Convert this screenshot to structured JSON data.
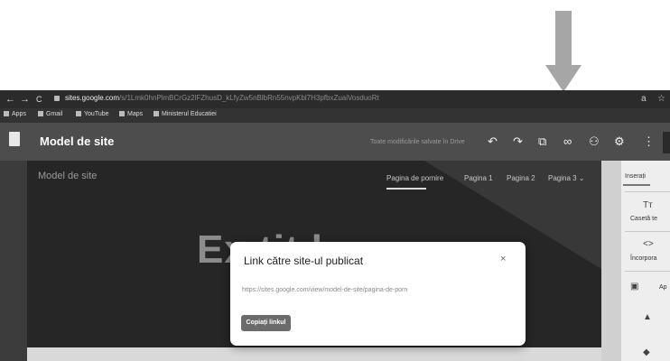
{
  "browser": {
    "url_host": "sites.google.com",
    "url_rest": "/s/1Lmk0hnPlmBCrGz2lFZhusD_kLfyZw5nBlbRn55nvpKbl7H3pfbxZuaiVosduoRt",
    "nav_back": "←",
    "nav_forward": "→",
    "nav_reload": "C",
    "ext1": "a",
    "ext2": "☆",
    "bookmarks": [
      "Apps",
      "Gmail",
      "YouTube",
      "Maps",
      "Ministerul Educatiei"
    ]
  },
  "editor": {
    "site_title": "Model de site",
    "saved_status": "Toate modificările salvate în Drive",
    "tools": {
      "undo": "↶",
      "redo": "↷",
      "preview": "⧉",
      "link": "∞",
      "share": "⚇",
      "settings": "⚙",
      "more": "⋮"
    }
  },
  "site": {
    "name": "Model de site",
    "nav": [
      "Pagina de pornire",
      "Pagina 1",
      "Pagina 2",
      "Pagina 3 ⌄"
    ],
    "hero_text": "Ex       tit   l"
  },
  "panel": {
    "tab": "Inserați",
    "items": [
      {
        "icon": "Tт",
        "label": "Casetă te"
      },
      {
        "icon": "<>",
        "label": "Încorpora"
      },
      {
        "icon": "▣",
        "label": "Ap"
      },
      {
        "icon": "▲",
        "label": ""
      },
      {
        "icon": "◆",
        "label": ""
      }
    ]
  },
  "dialog": {
    "title": "Link către site-ul publicat",
    "close": "×",
    "url": "https://sites.google.com/view/model-de-site/pagina-de-porn",
    "copy_button": "Copiați linkul"
  },
  "annotation": {
    "color": "#a6a6a6"
  }
}
